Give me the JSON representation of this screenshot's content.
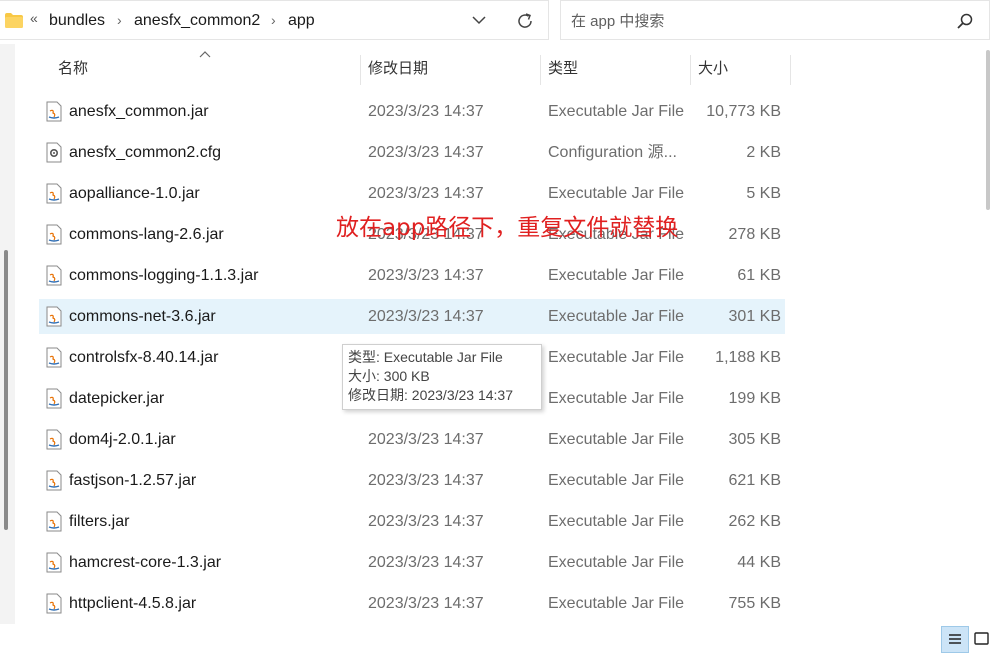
{
  "breadcrumb": {
    "overflow": "«",
    "items": [
      "bundles",
      "anesfx_common2",
      "app"
    ],
    "separator": "›"
  },
  "search": {
    "placeholder": "在 app 中搜索"
  },
  "columns": {
    "name": "名称",
    "date": "修改日期",
    "type": "类型",
    "size": "大小"
  },
  "files": [
    {
      "name": "anesfx_common.jar",
      "date": "2023/3/23 14:37",
      "type": "Executable Jar File",
      "size": "10,773 KB",
      "icon": "jar-file-icon"
    },
    {
      "name": "anesfx_common2.cfg",
      "date": "2023/3/23 14:37",
      "type": "Configuration 源...",
      "size": "2 KB",
      "icon": "config-file-icon"
    },
    {
      "name": "aopalliance-1.0.jar",
      "date": "2023/3/23 14:37",
      "type": "Executable Jar File",
      "size": "5 KB",
      "icon": "jar-file-icon"
    },
    {
      "name": "commons-lang-2.6.jar",
      "date": "2023/3/23 14:37",
      "type": "Executable Jar File",
      "size": "278 KB",
      "icon": "jar-file-icon"
    },
    {
      "name": "commons-logging-1.1.3.jar",
      "date": "2023/3/23 14:37",
      "type": "Executable Jar File",
      "size": "61 KB",
      "icon": "jar-file-icon"
    },
    {
      "name": "commons-net-3.6.jar",
      "date": "2023/3/23 14:37",
      "type": "Executable Jar File",
      "size": "301 KB",
      "icon": "jar-file-icon"
    },
    {
      "name": "controlsfx-8.40.14.jar",
      "date": "",
      "type": "Executable Jar File",
      "size": "1,188 KB",
      "icon": "jar-file-icon"
    },
    {
      "name": "datepicker.jar",
      "date": "",
      "type": "Executable Jar File",
      "size": "199 KB",
      "icon": "jar-file-icon"
    },
    {
      "name": "dom4j-2.0.1.jar",
      "date": "2023/3/23 14:37",
      "type": "Executable Jar File",
      "size": "305 KB",
      "icon": "jar-file-icon"
    },
    {
      "name": "fastjson-1.2.57.jar",
      "date": "2023/3/23 14:37",
      "type": "Executable Jar File",
      "size": "621 KB",
      "icon": "jar-file-icon"
    },
    {
      "name": "filters.jar",
      "date": "2023/3/23 14:37",
      "type": "Executable Jar File",
      "size": "262 KB",
      "icon": "jar-file-icon"
    },
    {
      "name": "hamcrest-core-1.3.jar",
      "date": "2023/3/23 14:37",
      "type": "Executable Jar File",
      "size": "44 KB",
      "icon": "jar-file-icon"
    },
    {
      "name": "httpclient-4.5.8.jar",
      "date": "2023/3/23 14:37",
      "type": "Executable Jar File",
      "size": "755 KB",
      "icon": "jar-file-icon"
    }
  ],
  "annotation": "放在app路径下，重复文件就替换",
  "tooltip": {
    "type_line": "类型: Executable Jar File",
    "size_line": "大小: 300 KB",
    "date_line": "修改日期: 2023/3/23 14:37"
  },
  "colors": {
    "selection": "#e5f3fb",
    "annotation": "#e02020",
    "folder": "#f8c845"
  }
}
